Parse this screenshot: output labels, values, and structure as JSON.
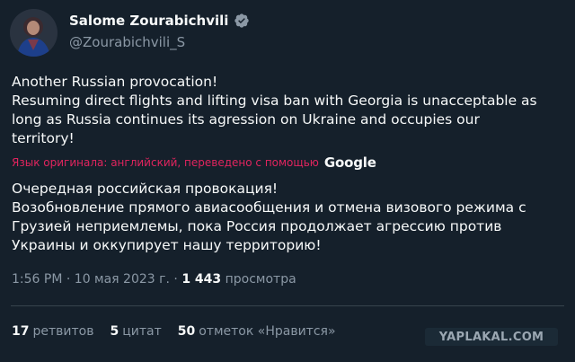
{
  "author": {
    "name": "Salome Zourabichvili",
    "handle": "@Zourabichvili_S",
    "verified_icon": "verified-badge-icon"
  },
  "tweet": {
    "lines": [
      "Another Russian provocation!",
      "Resuming direct flights and lifting visa ban with Georgia is unacceptable as",
      "long as Russia continues its agression on Ukraine and occupies our",
      "territory!"
    ]
  },
  "translation": {
    "label": "Язык оригинала: английский, переведено с помощью",
    "provider": "Google",
    "lines": [
      "Очередная российская провокация!",
      "Возобновление прямого авиасообщения и отмена визового режима с",
      "Грузией неприемлемы, пока Россия продолжает агрессию против",
      "Украины и оккупирует нашу территорию!"
    ]
  },
  "meta": {
    "time": "1:56 PM",
    "date": "10 мая 2023 г.",
    "separator": "·",
    "views_count": "1 443",
    "views_label": "просмотра"
  },
  "stats": {
    "retweets_count": "17",
    "retweets_label": "ретвитов",
    "quotes_count": "5",
    "quotes_label": "цитат",
    "likes_count": "50",
    "likes_label": "отметок «Нравится»"
  },
  "watermark": "YAPLAKAL.COM",
  "colors": {
    "background": "#15202b",
    "text": "#f7f9f9",
    "secondary": "#8b98a5",
    "translation": "#f91880",
    "verified": "#1d9bf0",
    "divider": "#38444d"
  }
}
